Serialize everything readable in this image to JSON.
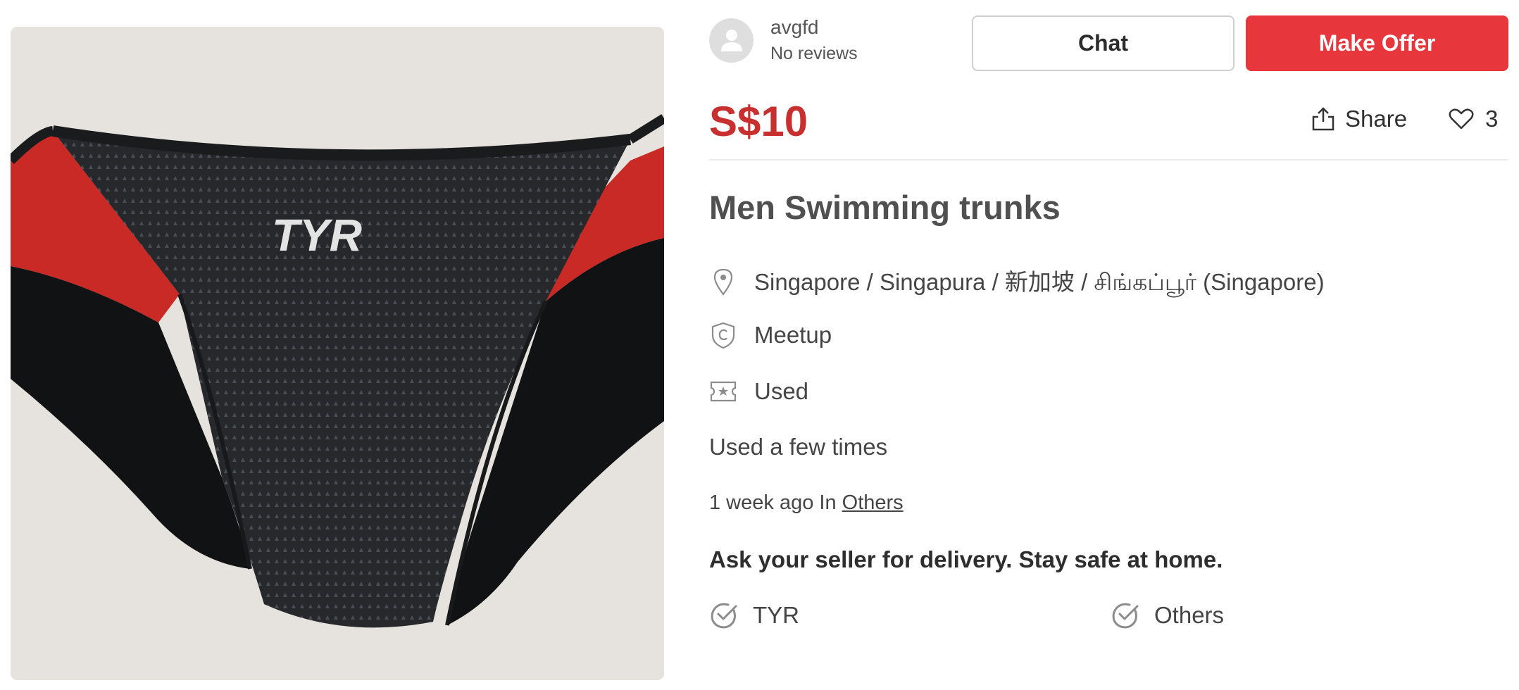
{
  "seller": {
    "username": "avgfd",
    "reviews": "No reviews",
    "avatar_icon": "user-avatar-icon"
  },
  "actions": {
    "chat_label": "Chat",
    "offer_label": "Make Offer"
  },
  "listing": {
    "price": "S$10",
    "share_label": "Share",
    "likes_count": "3",
    "title": "Men Swimming trunks",
    "location": "Singapore / Singapura / 新加坡 / சிங்கப்பூர் (Singapore)",
    "deal_method": "Meetup",
    "condition": "Used",
    "description": "Used a few times",
    "posted_time": "1 week ago In",
    "category_link": "Others",
    "delivery_notice": "Ask your seller for delivery. Stay safe at home.",
    "tags": [
      "TYR",
      "Others"
    ]
  },
  "photo": {
    "logo_text": "TYR"
  },
  "colors": {
    "accent_red": "#e8363d",
    "price_red": "#c7302f"
  }
}
